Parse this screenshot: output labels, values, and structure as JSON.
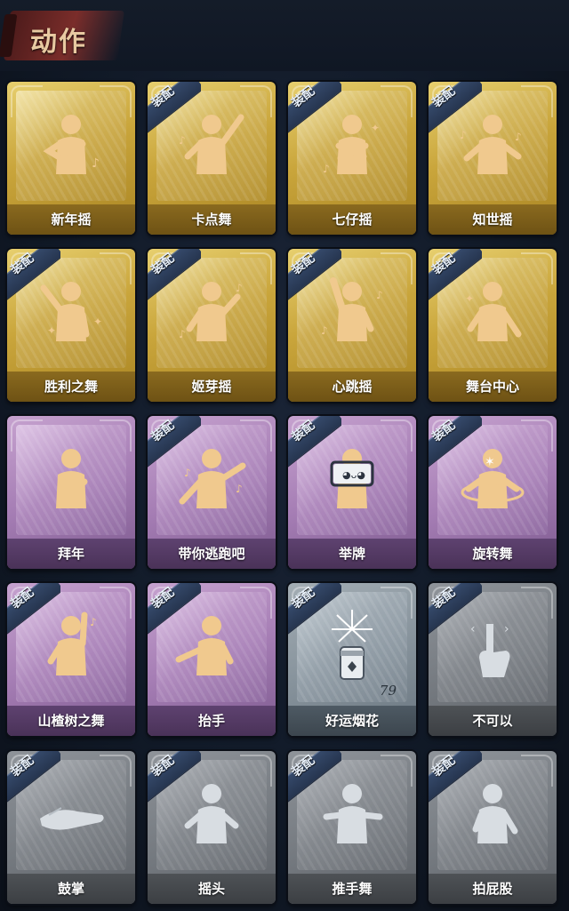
{
  "header": {
    "title": "动作"
  },
  "equip_label": "装配",
  "colors": {
    "gold": "#c9a53b",
    "purple": "#a57db4",
    "silver": "#87939c",
    "grey": "#74797f",
    "icon_gold": "#f0c98e",
    "icon_silver": "#d8dde2"
  },
  "cards": [
    {
      "name": "新年摇",
      "rarity": "gold",
      "equipped": false,
      "icon": "dancer-clap-icon"
    },
    {
      "name": "卡点舞",
      "rarity": "gold",
      "equipped": true,
      "icon": "dancer-point-up-icon"
    },
    {
      "name": "七仔摇",
      "rarity": "gold",
      "equipped": true,
      "icon": "dancer-cross-arms-icon"
    },
    {
      "name": "知世摇",
      "rarity": "gold",
      "equipped": true,
      "icon": "dancer-sway-icon"
    },
    {
      "name": "胜利之舞",
      "rarity": "gold",
      "equipped": true,
      "icon": "dancer-victory-icon"
    },
    {
      "name": "姬芽摇",
      "rarity": "gold",
      "equipped": true,
      "icon": "dancer-wave-icon"
    },
    {
      "name": "心跳摇",
      "rarity": "gold",
      "equipped": true,
      "icon": "dancer-heartbeat-icon"
    },
    {
      "name": "舞台中心",
      "rarity": "gold",
      "equipped": true,
      "icon": "dancer-center-stage-icon"
    },
    {
      "name": "拜年",
      "rarity": "purple",
      "equipped": false,
      "icon": "person-bow-icon"
    },
    {
      "name": "带你逃跑吧",
      "rarity": "purple",
      "equipped": true,
      "icon": "dancer-run-icon"
    },
    {
      "name": "举牌",
      "rarity": "purple",
      "equipped": true,
      "icon": "person-hold-sign-icon"
    },
    {
      "name": "旋转舞",
      "rarity": "purple",
      "equipped": true,
      "icon": "dancer-spin-icon"
    },
    {
      "name": "山楂树之舞",
      "rarity": "purple",
      "equipped": true,
      "icon": "dancer-arm-up-icon"
    },
    {
      "name": "抬手",
      "rarity": "purple",
      "equipped": true,
      "icon": "person-raise-hand-icon"
    },
    {
      "name": "好运烟花",
      "rarity": "silver",
      "equipped": true,
      "icon": "firework-icon",
      "count": "79"
    },
    {
      "name": "不可以",
      "rarity": "grey",
      "equipped": true,
      "icon": "finger-wag-icon"
    },
    {
      "name": "鼓掌",
      "rarity": "grey",
      "equipped": true,
      "icon": "clapping-hands-icon"
    },
    {
      "name": "摇头",
      "rarity": "grey",
      "equipped": true,
      "icon": "person-shake-head-icon"
    },
    {
      "name": "推手舞",
      "rarity": "grey",
      "equipped": true,
      "icon": "person-push-hands-icon"
    },
    {
      "name": "拍屁股",
      "rarity": "grey",
      "equipped": true,
      "icon": "person-pat-icon"
    }
  ]
}
